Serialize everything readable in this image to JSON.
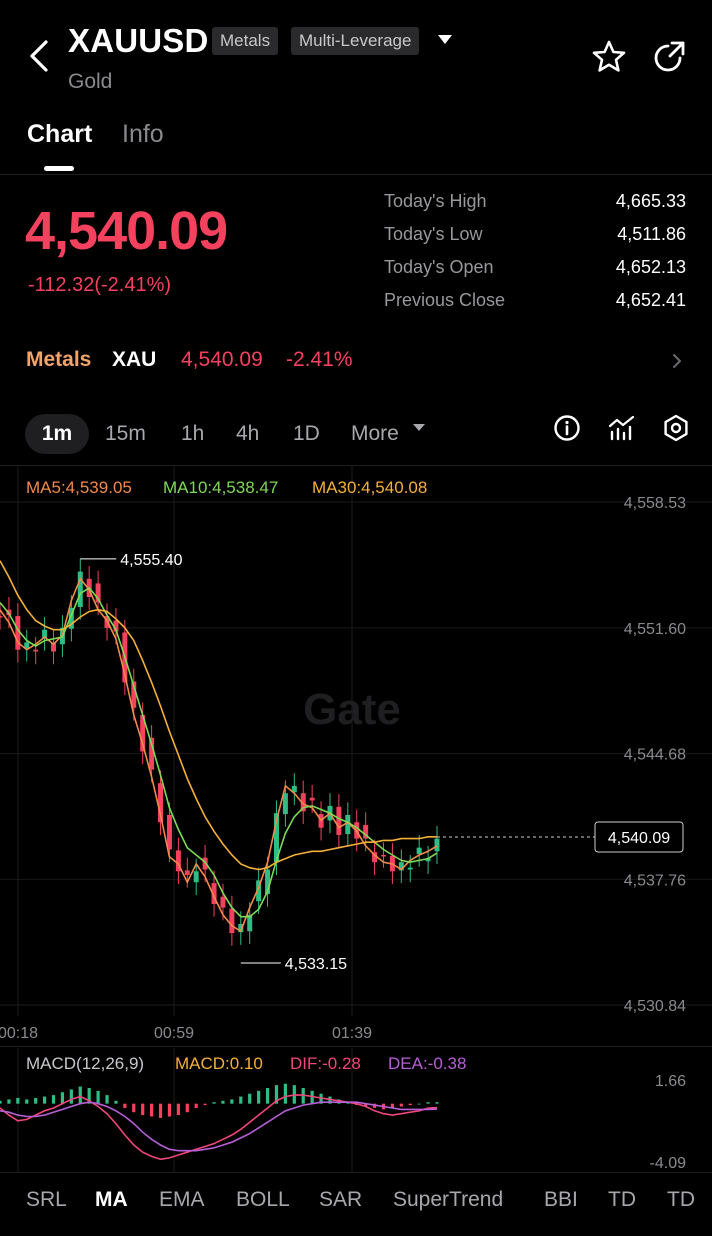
{
  "header": {
    "symbol": "XAUUSD",
    "tags": [
      "Metals",
      "Multi-Leverage"
    ],
    "name": "Gold"
  },
  "tabs": {
    "chart": "Chart",
    "info": "Info"
  },
  "price": {
    "last": "4,540.09",
    "change": "-112.32(-2.41%)",
    "stats": [
      {
        "label": "Today's High",
        "value": "4,665.33"
      },
      {
        "label": "Today's Low",
        "value": "4,511.86"
      },
      {
        "label": "Today's Open",
        "value": "4,652.13"
      },
      {
        "label": "Previous Close",
        "value": "4,652.41"
      }
    ]
  },
  "metals_row": {
    "category": "Metals",
    "asset": "XAU",
    "price": "4,540.09",
    "change": "-2.41%"
  },
  "timeframes": [
    "1m",
    "15m",
    "1h",
    "4h",
    "1D",
    "More"
  ],
  "ma_legend": {
    "ma5": "MA5:4,539.05",
    "ma10": "MA10:4,538.47",
    "ma30": "MA30:4,540.08"
  },
  "watermark": "Gate",
  "colors": {
    "up": "#2ebd85",
    "down": "#f4415e",
    "ma5": "#f08a4b",
    "ma10": "#7ed957",
    "ma30": "#f5b03a",
    "dif": "#f0467a",
    "dea": "#b65fd6",
    "macd": "#f5b03a"
  },
  "chart_data": [
    {
      "type": "line",
      "title": "",
      "y_ticks": [
        "4,558.53",
        "4,551.60",
        "4,544.68",
        "4,537.76",
        "4,530.84"
      ],
      "x_ticks": [
        "00:18",
        "00:59",
        "01:39"
      ],
      "ylim": [
        4530.84,
        4558.53
      ],
      "annotations": {
        "high": "4,555.40",
        "low": "4,533.15",
        "last": "4,540.09"
      },
      "x": [
        0,
        3,
        6,
        9,
        12,
        15,
        18,
        21,
        24,
        27,
        30,
        33,
        36,
        39,
        42,
        45,
        48,
        51,
        54,
        57,
        60,
        63,
        66,
        69,
        72,
        75,
        78,
        81,
        84,
        87,
        90,
        93,
        96,
        99,
        102,
        105,
        108,
        111,
        114,
        117,
        120,
        123,
        126,
        129,
        132,
        135,
        138,
        141,
        144,
        147
      ],
      "series": [
        {
          "name": "MA5",
          "values": [
            4552.6,
            4551.9,
            4550.8,
            4550.4,
            4550.7,
            4551.1,
            4550.7,
            4551.2,
            4553.1,
            4554.3,
            4553.7,
            4552.6,
            4552.0,
            4551.0,
            4549.0,
            4546.8,
            4545.2,
            4543.4,
            4541.3,
            4539.0,
            4538.6,
            4537.6,
            4538.6,
            4537.9,
            4536.8,
            4535.8,
            4535.2,
            4534.9,
            4536.2,
            4537.3,
            4538.7,
            4541.0,
            4542.9,
            4542.5,
            4541.9,
            4541.7,
            4541.0,
            4541.4,
            4540.6,
            4540.9,
            4540.4,
            4539.6,
            4539.1,
            4538.7,
            4538.6,
            4538.3,
            4538.8,
            4539.1,
            4539.3,
            4539.6
          ]
        },
        {
          "name": "MA10",
          "values": [
            4553.0,
            4552.4,
            4551.5,
            4550.9,
            4550.6,
            4550.9,
            4551.0,
            4551.1,
            4552.3,
            4553.5,
            4553.8,
            4553.2,
            4552.3,
            4551.5,
            4550.0,
            4548.4,
            4546.8,
            4545.2,
            4543.5,
            4541.7,
            4540.5,
            4539.5,
            4539.1,
            4538.7,
            4538.0,
            4537.0,
            4536.2,
            4535.7,
            4535.7,
            4536.1,
            4537.1,
            4538.8,
            4540.3,
            4541.2,
            4541.7,
            4541.8,
            4541.6,
            4541.4,
            4541.1,
            4540.9,
            4540.6,
            4540.2,
            4539.8,
            4539.4,
            4539.1,
            4538.8,
            4538.7,
            4538.8,
            4538.9,
            4539.2
          ]
        },
        {
          "name": "MA30",
          "values": [
            4555.3,
            4554.4,
            4553.4,
            4552.6,
            4552.0,
            4551.7,
            4551.5,
            4551.5,
            4551.8,
            4552.2,
            4552.5,
            4552.6,
            4552.5,
            4552.1,
            4551.6,
            4550.9,
            4549.8,
            4548.6,
            4547.3,
            4545.9,
            4544.6,
            4543.3,
            4542.2,
            4541.2,
            4540.4,
            4539.7,
            4539.1,
            4538.6,
            4538.4,
            4538.3,
            4538.4,
            4538.7,
            4538.9,
            4539.1,
            4539.2,
            4539.3,
            4539.3,
            4539.4,
            4539.5,
            4539.6,
            4539.7,
            4539.8,
            4539.8,
            4539.9,
            4539.9,
            4540.0,
            4540.0,
            4540.0,
            4540.1,
            4540.1
          ]
        }
      ]
    },
    {
      "type": "bar",
      "title": "",
      "legend": {
        "label": "MACD(12,26,9)",
        "macd": "MACD:0.10",
        "dif": "DIF:-0.28",
        "dea": "DEA:-0.38"
      },
      "y_ticks": [
        "1.66",
        "-4.09"
      ],
      "ylim": [
        -4.09,
        1.66
      ],
      "x": [
        0,
        3,
        6,
        9,
        12,
        15,
        18,
        21,
        24,
        27,
        30,
        33,
        36,
        39,
        42,
        45,
        48,
        51,
        54,
        57,
        60,
        63,
        66,
        69,
        72,
        75,
        78,
        81,
        84,
        87,
        90,
        93,
        96,
        99,
        102,
        105,
        108,
        111,
        114,
        117,
        120,
        123,
        126,
        129,
        132,
        135,
        138,
        141,
        144,
        147
      ],
      "histogram": [
        0.2,
        0.3,
        0.4,
        0.3,
        0.4,
        0.5,
        0.6,
        0.8,
        1.0,
        1.2,
        1.1,
        0.9,
        0.6,
        0.2,
        -0.3,
        -0.6,
        -0.8,
        -0.9,
        -1.0,
        -0.9,
        -0.8,
        -0.6,
        -0.3,
        -0.1,
        0.1,
        0.2,
        0.3,
        0.5,
        0.7,
        0.9,
        1.1,
        1.3,
        1.4,
        1.3,
        1.1,
        0.9,
        0.7,
        0.5,
        0.3,
        0.1,
        -0.1,
        -0.2,
        -0.3,
        -0.4,
        -0.3,
        -0.2,
        -0.1,
        0.0,
        0.1,
        0.1
      ],
      "series": [
        {
          "name": "DIF",
          "values": [
            -0.3,
            -0.8,
            -1.2,
            -1.1,
            -0.8,
            -0.5,
            -0.3,
            0.0,
            0.3,
            0.5,
            0.2,
            -0.2,
            -0.7,
            -1.4,
            -2.2,
            -2.9,
            -3.4,
            -3.7,
            -3.9,
            -3.8,
            -3.6,
            -3.4,
            -3.2,
            -3.0,
            -2.8,
            -2.5,
            -2.2,
            -1.8,
            -1.3,
            -0.8,
            -0.3,
            0.2,
            0.5,
            0.6,
            0.6,
            0.5,
            0.4,
            0.3,
            0.2,
            0.1,
            0.0,
            -0.2,
            -0.5,
            -0.7,
            -0.8,
            -0.7,
            -0.6,
            -0.5,
            -0.3,
            -0.28
          ]
        },
        {
          "name": "DEA",
          "values": [
            -0.5,
            -0.6,
            -0.8,
            -0.9,
            -0.9,
            -0.8,
            -0.6,
            -0.4,
            -0.2,
            0.0,
            0.1,
            0.0,
            -0.2,
            -0.5,
            -0.9,
            -1.4,
            -2.0,
            -2.5,
            -2.9,
            -3.2,
            -3.3,
            -3.3,
            -3.3,
            -3.2,
            -3.1,
            -2.9,
            -2.7,
            -2.4,
            -2.1,
            -1.7,
            -1.3,
            -0.9,
            -0.5,
            -0.3,
            -0.1,
            0.0,
            0.1,
            0.1,
            0.1,
            0.1,
            0.1,
            0.0,
            -0.1,
            -0.2,
            -0.3,
            -0.4,
            -0.4,
            -0.4,
            -0.4,
            -0.38
          ]
        }
      ]
    }
  ],
  "indicators": [
    "SRL",
    "MA",
    "EMA",
    "BOLL",
    "SAR",
    "SuperTrend",
    "BBI",
    "TD",
    "TD"
  ]
}
